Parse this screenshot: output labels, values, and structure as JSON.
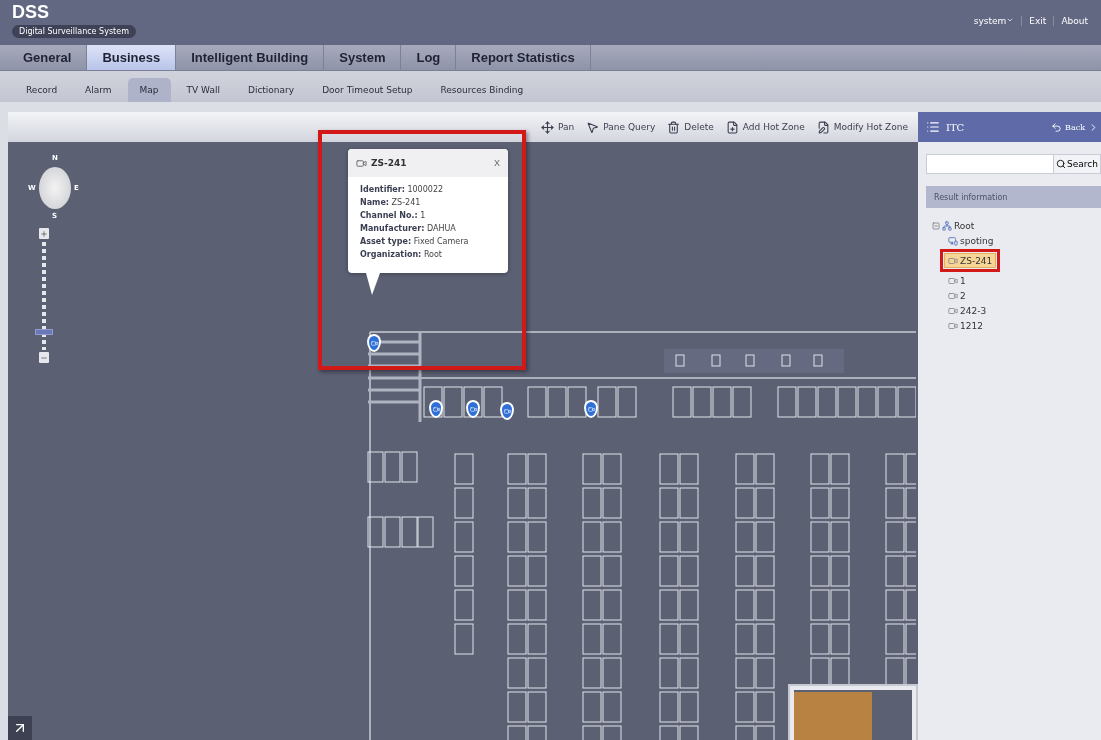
{
  "header": {
    "logo": "DSS",
    "subtitle": "Digital Surveillance System",
    "user_menu": "system",
    "links": [
      "Exit",
      "About"
    ]
  },
  "main_tabs": [
    {
      "label": "General",
      "selected": false
    },
    {
      "label": "Business",
      "selected": true
    },
    {
      "label": "Intelligent Building",
      "selected": false
    },
    {
      "label": "System",
      "selected": false
    },
    {
      "label": "Log",
      "selected": false
    },
    {
      "label": "Report Statistics",
      "selected": false
    }
  ],
  "sub_tabs": [
    {
      "label": "Record",
      "selected": false
    },
    {
      "label": "Alarm",
      "selected": false
    },
    {
      "label": "Map",
      "selected": true
    },
    {
      "label": "TV Wall",
      "selected": false
    },
    {
      "label": "Dictionary",
      "selected": false
    },
    {
      "label": "Door Timeout Setup",
      "selected": false
    },
    {
      "label": "Resources Binding",
      "selected": false
    }
  ],
  "toolbar": [
    {
      "kind": "pan",
      "label": "Pan"
    },
    {
      "kind": "query",
      "label": "Pane Query"
    },
    {
      "kind": "delete",
      "label": "Delete"
    },
    {
      "kind": "add",
      "label": "Add Hot Zone"
    },
    {
      "kind": "modify",
      "label": "Modify Hot Zone"
    }
  ],
  "map": {
    "compass": {
      "north": "N",
      "west": "W",
      "east": "E",
      "south": "S"
    },
    "zoom": {
      "level": 0.15
    },
    "popup": {
      "title": "ZS-241",
      "close": "X",
      "fields": [
        {
          "label": "Identifier:",
          "value": "1000022"
        },
        {
          "label": "Name:",
          "value": "ZS-241"
        },
        {
          "label": "Channel No.:",
          "value": "1"
        },
        {
          "label": "Manufacturer:",
          "value": "DAHUA"
        },
        {
          "label": "Asset type:",
          "value": "Fixed Camera"
        },
        {
          "label": "Organization:",
          "value": "Root"
        }
      ]
    }
  },
  "side_panel": {
    "title": "ITC",
    "back": "Back",
    "search": {
      "button": "Search"
    },
    "result_header": "Result information",
    "tree": [
      {
        "label": "Root",
        "kind": "org",
        "expanded": true,
        "selected": false,
        "children": [
          {
            "label": "spoting",
            "kind": "group",
            "selected": false
          },
          {
            "label": "ZS-241",
            "kind": "camera",
            "selected": true
          },
          {
            "label": "1",
            "kind": "camera",
            "selected": false
          },
          {
            "label": "2",
            "kind": "camera",
            "selected": false
          },
          {
            "label": "242-3",
            "kind": "camera",
            "selected": false
          },
          {
            "label": "1212",
            "kind": "camera",
            "selected": false
          }
        ]
      }
    ]
  }
}
